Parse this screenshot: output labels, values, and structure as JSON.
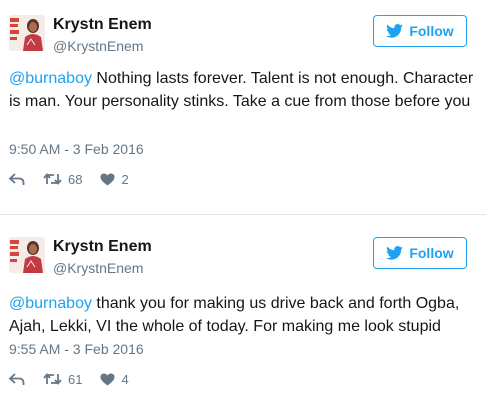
{
  "tweets": [
    {
      "name": "Krystn Enem",
      "handle": "@KrystnEnem",
      "follow_label": "Follow",
      "mention": "@burnaboy",
      "text": " Nothing lasts forever. Talent is not enough. Character is man. Your personality stinks. Take a cue from those before you",
      "time": "9:50 AM - 3 Feb 2016",
      "retweets": "68",
      "likes": "2"
    },
    {
      "name": "Krystn Enem",
      "handle": "@KrystnEnem",
      "follow_label": "Follow",
      "mention": "@burnaboy",
      "text": " thank you for making us drive back and forth Ogba, Ajah, Lekki, VI the whole of today. For making me look stupid",
      "time": "9:55 AM - 3 Feb 2016",
      "retweets": "61",
      "likes": "4"
    }
  ],
  "colors": {
    "accent": "#1da1f2",
    "muted": "#657786",
    "text": "#14171a",
    "divider": "#e1e8ed"
  },
  "icons": [
    "twitter-bird-icon",
    "reply-icon",
    "retweet-icon",
    "heart-icon"
  ]
}
